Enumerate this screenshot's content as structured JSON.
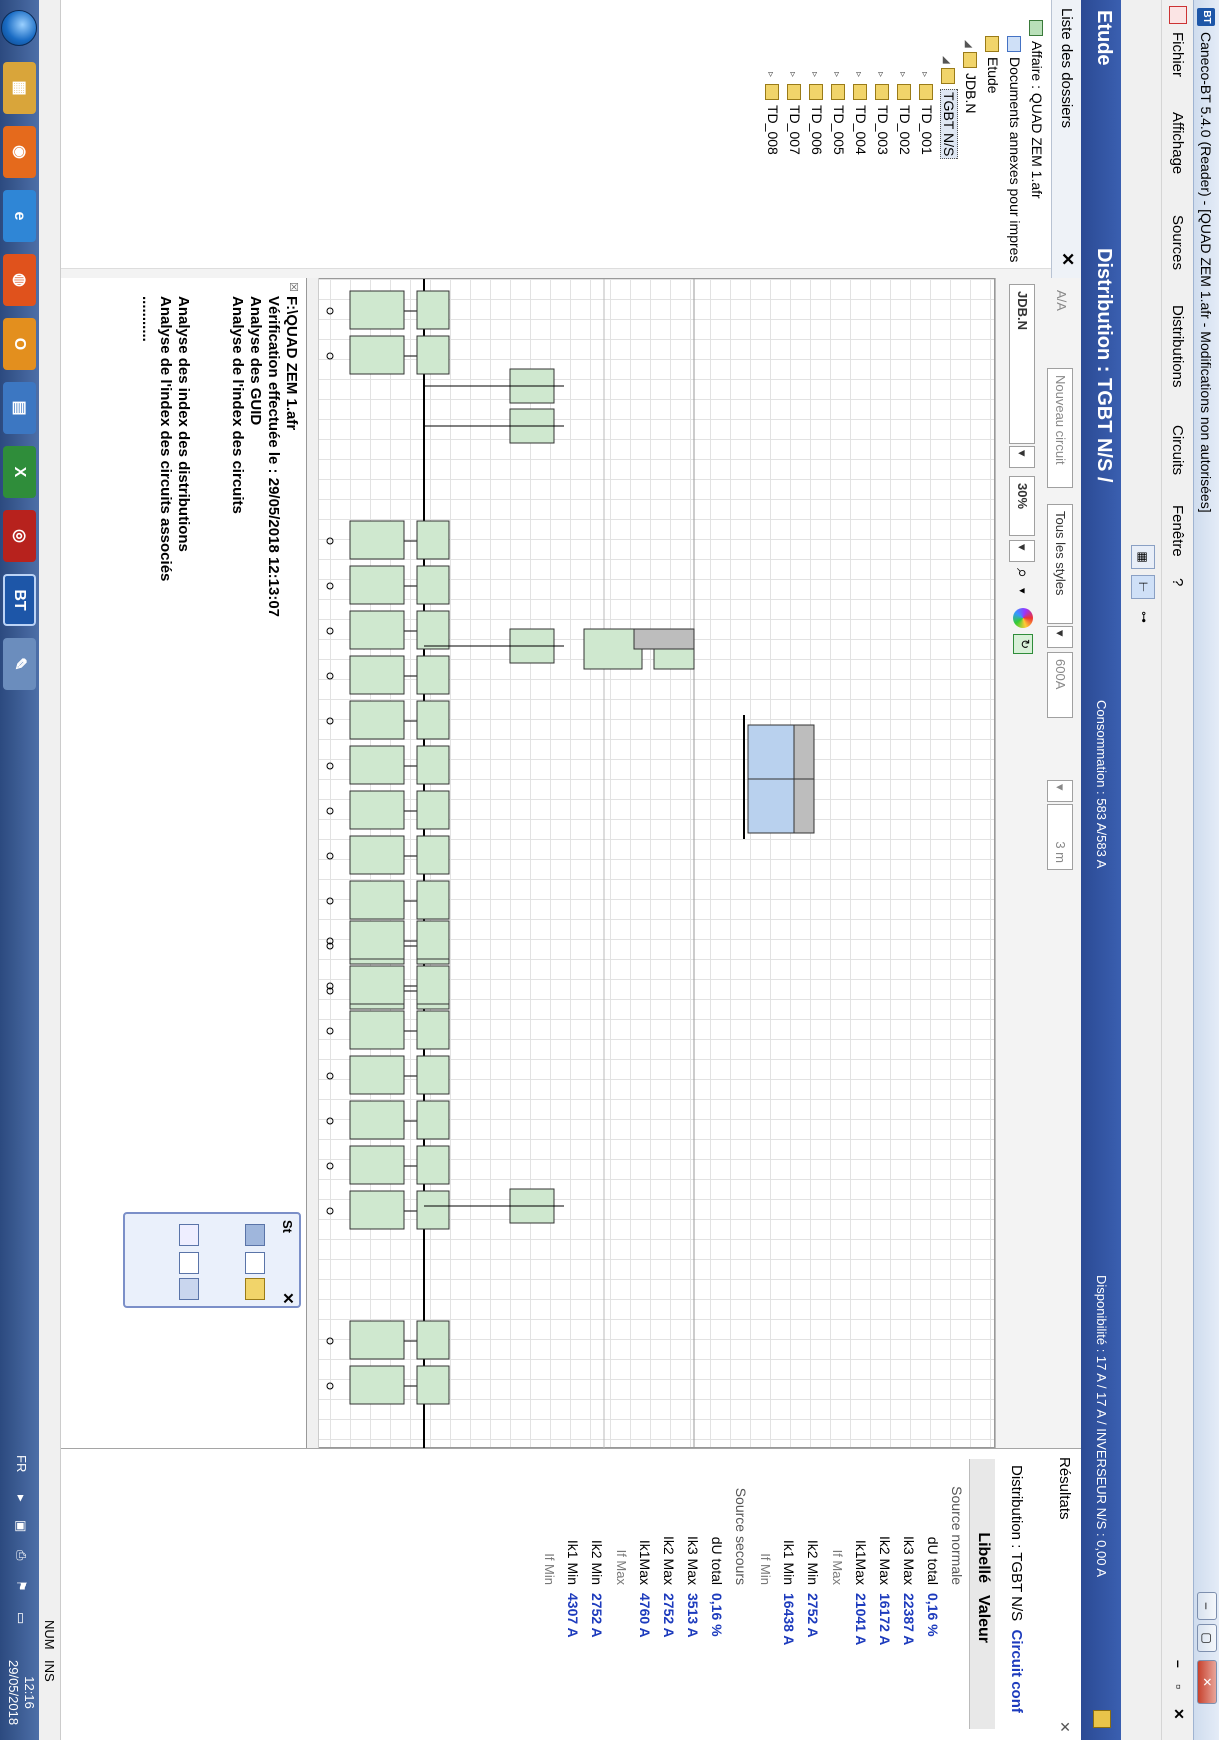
{
  "window": {
    "title": "Caneco-BT 5.4.0 (Reader) - [QUAD ZEM 1.afr - Modifications non autorisées]",
    "app_badge": "BT",
    "controls": [
      "–",
      "▢",
      "✕"
    ]
  },
  "menu": {
    "items": [
      "Fichier",
      "Affichage",
      "Sources",
      "Distributions",
      "Circuits",
      "Fenêtre",
      "?"
    ],
    "mdi_controls": [
      "–",
      "▫",
      "✕"
    ]
  },
  "header": {
    "section": "Etude",
    "title": "Distribution : TGBT N/S /",
    "consommation": "Consommation : 583 A/583 A",
    "disponibilite": "Disponibilité : 17 A / 17 A  / INVERSEUR N/S : 0,00 A"
  },
  "tree": {
    "title": "Liste des dossiers",
    "close": "✕",
    "items": [
      {
        "label": "Affaire : QUAD ZEM 1.afr",
        "type": "aff",
        "level": 0
      },
      {
        "label": "Documents annexes pour impres",
        "type": "doc",
        "level": 1
      },
      {
        "label": "Etude",
        "type": "fold",
        "level": 1
      },
      {
        "label": "JDB.N",
        "type": "fold",
        "level": 2
      },
      {
        "label": "TGBT N/S",
        "type": "fold",
        "level": 3
      },
      {
        "label": "TD_001",
        "type": "fold",
        "level": 4
      },
      {
        "label": "TD_002",
        "type": "fold",
        "level": 4
      },
      {
        "label": "TD_003",
        "type": "fold",
        "level": 4
      },
      {
        "label": "TD_004",
        "type": "fold",
        "level": 4
      },
      {
        "label": "TD_005",
        "type": "fold",
        "level": 4
      },
      {
        "label": "TD_006",
        "type": "fold",
        "level": 4
      },
      {
        "label": "TD_007",
        "type": "fold",
        "level": 4
      },
      {
        "label": "TD_008",
        "type": "fold",
        "level": 4
      }
    ]
  },
  "diagram_toolbar": {
    "style_a": "A/A",
    "new_circuit": "Nouveau circuit",
    "all_styles": "Tous les styles",
    "current": "600A",
    "length": "3 m",
    "distribution_select": "JDB.N",
    "zoom": "30%"
  },
  "log": {
    "path": "F:\\QUAD ZEM 1.afr",
    "verification": "Vérification effectuée le : 29/05/2018 12:13:07",
    "lines": [
      "Analyse des GUID",
      "Analyse de l'index des circuits",
      "",
      "",
      "Analyse des index des distributions",
      "Analyse de l'index des circuits associés",
      "..........."
    ]
  },
  "results": {
    "tab": "Résultats",
    "close": "✕",
    "distribution_label": "Distribution : TGBT N/S",
    "distribution_link": "Circuit conf",
    "col_label": "Libellé",
    "col_value": "Valeur",
    "rows": [
      {
        "label": "Source normale",
        "value": "",
        "kind": "sec"
      },
      {
        "label": "dU total",
        "value": "0,16 %",
        "kind": "row"
      },
      {
        "label": "Ik3 Max",
        "value": "22387 A",
        "kind": "row"
      },
      {
        "label": "Ik2 Max",
        "value": "16172 A",
        "kind": "row"
      },
      {
        "label": "Ik1Max",
        "value": "21041 A",
        "kind": "row"
      },
      {
        "label": "If Max",
        "value": "",
        "kind": "sub"
      },
      {
        "label": "Ik2 Min",
        "value": "2752 A",
        "kind": "row"
      },
      {
        "label": "Ik1 Min",
        "value": "16438 A",
        "kind": "row"
      },
      {
        "label": "If Min",
        "value": "",
        "kind": "sub"
      },
      {
        "label": "Source secours",
        "value": "",
        "kind": "sec"
      },
      {
        "label": "dU total",
        "value": "0,16 %",
        "kind": "row"
      },
      {
        "label": "Ik3 Max",
        "value": "3513 A",
        "kind": "row"
      },
      {
        "label": "Ik2 Max",
        "value": "2752 A",
        "kind": "row"
      },
      {
        "label": "Ik1Max",
        "value": "4760 A",
        "kind": "row"
      },
      {
        "label": "If Max",
        "value": "",
        "kind": "sub"
      },
      {
        "label": "Ik2 Min",
        "value": "2752 A",
        "kind": "row"
      },
      {
        "label": "Ik1 Min",
        "value": "4307 A",
        "kind": "row"
      },
      {
        "label": "If Min",
        "value": "",
        "kind": "sub"
      }
    ]
  },
  "palette": {
    "title": "St",
    "close": "✕"
  },
  "status": {
    "num": "NUM",
    "ins": "INS"
  },
  "taskbar": {
    "lang": "FR",
    "time": "12:16",
    "date": "29/05/2018",
    "apps": [
      {
        "name": "explorer",
        "color": "#d9a53a",
        "glyph": "▦"
      },
      {
        "name": "outlook-express",
        "color": "#e56a1c",
        "glyph": "◉"
      },
      {
        "name": "internet-explorer",
        "color": "#2f86d6",
        "glyph": "e"
      },
      {
        "name": "firefox",
        "color": "#e0521c",
        "glyph": "◍"
      },
      {
        "name": "outlook",
        "color": "#e38f1e",
        "glyph": "O"
      },
      {
        "name": "remote-desktop",
        "color": "#3c77c2",
        "glyph": "▤"
      },
      {
        "name": "excel",
        "color": "#2f8d3a",
        "glyph": "X"
      },
      {
        "name": "autocad",
        "color": "#b7221d",
        "glyph": "◎"
      },
      {
        "name": "caneco-bt",
        "color": "#1d56a8",
        "glyph": "BT"
      },
      {
        "name": "paint",
        "color": "#6b8dbd",
        "glyph": "✎"
      }
    ]
  }
}
